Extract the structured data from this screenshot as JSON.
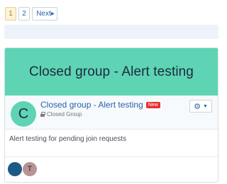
{
  "pagination": {
    "pages": [
      "1",
      "2"
    ],
    "active": "1",
    "next_label": "Next▸"
  },
  "hero": {
    "title": "Closed group - Alert testing"
  },
  "group": {
    "avatar_letter": "C",
    "name": "Closed group - Alert testing",
    "badge": "New",
    "type_label": "Closed Group",
    "description": "Alert testing for pending join requests"
  },
  "members": [
    {
      "initial": ""
    },
    {
      "initial": "T"
    }
  ],
  "colors": {
    "hero": "#5ed4b4",
    "badge": "#e43030",
    "link": "#2a62a8"
  }
}
